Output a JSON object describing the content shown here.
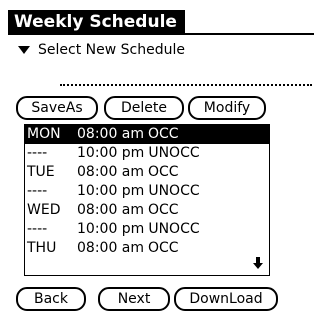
{
  "window": {
    "title": "Weekly Schedule"
  },
  "selector": {
    "label": "Select New Schedule"
  },
  "buttons": {
    "save_as": "SaveAs",
    "delete": "Delete",
    "modify": "Modify",
    "back": "Back",
    "next": "Next",
    "download": "DownLoad"
  },
  "schedule": {
    "selected_index": 0,
    "rows": [
      {
        "day": "MON",
        "time": "08:00 am",
        "state": "OCC"
      },
      {
        "day": "----",
        "time": "10:00 pm",
        "state": "UNOCC"
      },
      {
        "day": "TUE",
        "time": "08:00 am",
        "state": "OCC"
      },
      {
        "day": "----",
        "time": "10:00 pm",
        "state": "UNOCC"
      },
      {
        "day": "WED",
        "time": "08:00 am",
        "state": "OCC"
      },
      {
        "day": "----",
        "time": "10:00 pm",
        "state": "UNOCC"
      },
      {
        "day": "THU",
        "time": "08:00 am",
        "state": "OCC"
      }
    ],
    "scroll_icon": "down-arrow-icon"
  }
}
